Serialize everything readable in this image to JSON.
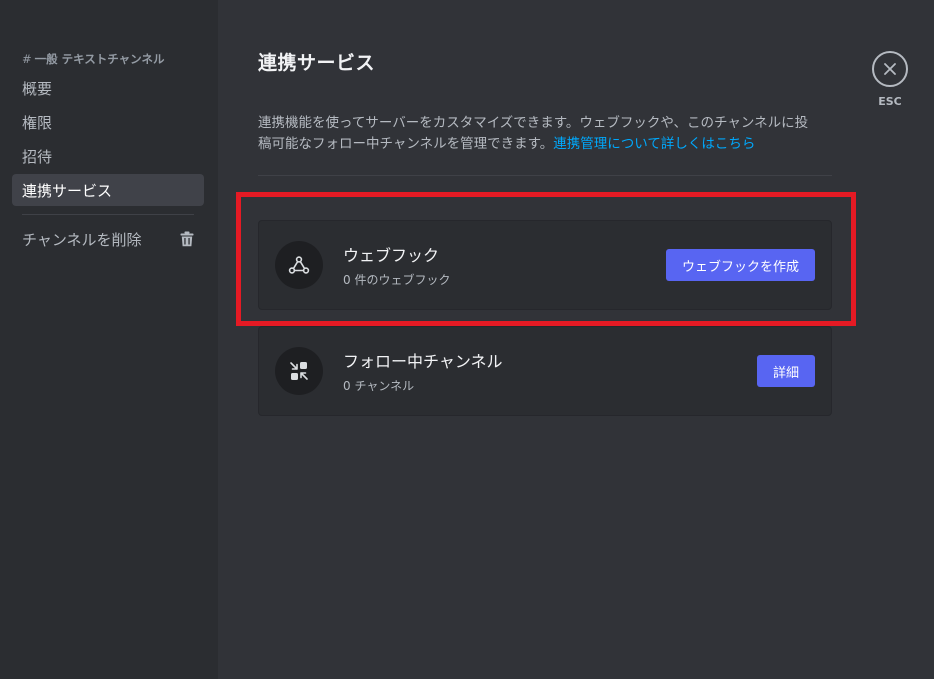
{
  "sidebar": {
    "header_hash": "#",
    "header_label": "一般 テキストチャンネル",
    "items": [
      {
        "label": "概要"
      },
      {
        "label": "権限"
      },
      {
        "label": "招待"
      },
      {
        "label": "連携サービス",
        "active": true
      }
    ],
    "delete_label": "チャンネルを削除",
    "delete_icon": "trash-icon"
  },
  "main": {
    "title": "連携サービス",
    "description_line1": "連携機能を使ってサーバーをカスタマイズできます。ウェブフックや、このチャンネルに投",
    "description_line2": "稿可能なフォロー中チャンネルを管理できます。",
    "description_link": "連携管理について詳しくはこちら"
  },
  "cards": {
    "webhook": {
      "icon": "webhook-icon",
      "title": "ウェブフック",
      "subtitle": "0 件のウェブフック",
      "button": "ウェブフックを作成"
    },
    "followed": {
      "icon": "followed-channels-icon",
      "title": "フォロー中チャンネル",
      "subtitle": "0 チャンネル",
      "button": "詳細"
    }
  },
  "close": {
    "icon": "close-icon",
    "label": "ESC"
  },
  "colors": {
    "accent": "#5865f2",
    "link": "#00a8fc",
    "highlight": "#e51a24",
    "background": "#313338",
    "sidebar": "#2b2d31"
  }
}
